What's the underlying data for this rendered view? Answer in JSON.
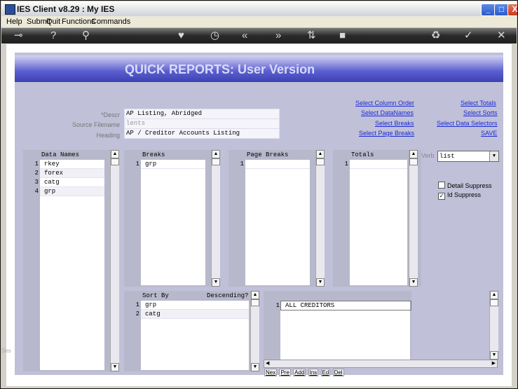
{
  "window": {
    "title": "IES Client v8.29 : My IES",
    "controls": {
      "minimize": "_",
      "maximize": "□",
      "close": "X"
    }
  },
  "menu": [
    "Help",
    "Submit",
    "Quit",
    "Functions",
    "Commands"
  ],
  "toolbar_icons": [
    "key-icon",
    "help-icon",
    "search-icon",
    "heart-icon",
    "clock-icon",
    "rewind-icon",
    "forward-icon",
    "sort-icon",
    "stop-icon",
    "recycle-icon",
    "check-icon",
    "close-icon"
  ],
  "toolbar_glyphs": {
    "key": "⊸",
    "help": "?",
    "search": "⚲",
    "heart": "♥",
    "clock": "◷",
    "rewind": "«",
    "forward": "»",
    "sort": "⇅",
    "stop": "■",
    "recycle": "♻",
    "check": "✓",
    "close": "✕"
  },
  "header": {
    "title": "QUICK REPORTS: User Version"
  },
  "form": {
    "descr_label": "*Descr",
    "descr_value": "AP Listing, Abridged",
    "source_label": "Source Filename",
    "source_value": "lents",
    "heading_label": "Heading",
    "heading_value": "AP / Creditor Accounts Listing"
  },
  "links": {
    "col1": [
      "Select Column Order",
      "Select DataNames",
      "Select Breaks",
      "Select Page Breaks"
    ],
    "col2": [
      "Select Totals",
      "Select Sorts",
      "Select Data Selectors",
      "SAVE"
    ]
  },
  "panels": {
    "data_names": {
      "header": "Data Names",
      "rows": [
        {
          "num": "1",
          "value": "rkey"
        },
        {
          "num": "2",
          "value": "forex"
        },
        {
          "num": "3",
          "value": "catg"
        },
        {
          "num": "4",
          "value": "grp"
        }
      ]
    },
    "breaks": {
      "header": "Breaks",
      "rows": [
        {
          "num": "1",
          "value": "grp"
        }
      ]
    },
    "page_breaks": {
      "header": "Page Breaks",
      "rows": [
        {
          "num": "1",
          "value": ""
        }
      ]
    },
    "totals": {
      "header": "Totals",
      "rows": [
        {
          "num": "1",
          "value": ""
        }
      ]
    },
    "sort_by": {
      "header": "Sort By",
      "header2": "Descending?",
      "rows": [
        {
          "num": "1",
          "value": "grp"
        },
        {
          "num": "2",
          "value": "catg"
        }
      ]
    },
    "selectors": {
      "rows": [
        {
          "num": "1",
          "value": "ALL CREDITORS"
        }
      ]
    }
  },
  "verb": {
    "label": "Verb",
    "value": "list"
  },
  "options": {
    "detail_suppress": {
      "label": "Detail Suppress",
      "checked": false
    },
    "id_suppress": {
      "label": "Id Suppress",
      "checked": true
    }
  },
  "nav_buttons": [
    "Nex",
    "Pre",
    "Add",
    "Ins",
    "Ed",
    "Del"
  ],
  "side_fragment": "Ses"
}
